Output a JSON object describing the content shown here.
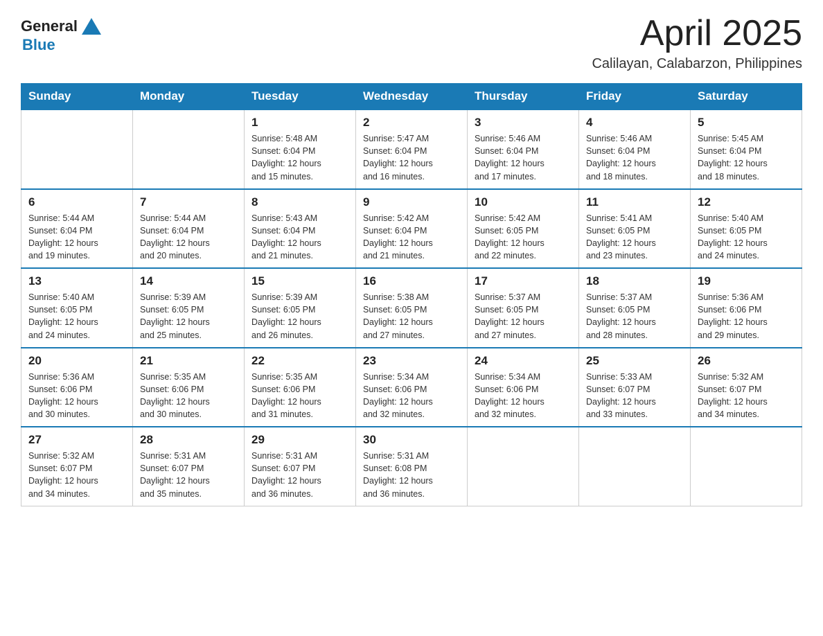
{
  "header": {
    "logo_text_general": "General",
    "logo_text_blue": "Blue",
    "title": "April 2025",
    "subtitle": "Calilayan, Calabarzon, Philippines"
  },
  "days_of_week": [
    "Sunday",
    "Monday",
    "Tuesday",
    "Wednesday",
    "Thursday",
    "Friday",
    "Saturday"
  ],
  "weeks": [
    [
      {
        "day": "",
        "info": ""
      },
      {
        "day": "",
        "info": ""
      },
      {
        "day": "1",
        "info": "Sunrise: 5:48 AM\nSunset: 6:04 PM\nDaylight: 12 hours\nand 15 minutes."
      },
      {
        "day": "2",
        "info": "Sunrise: 5:47 AM\nSunset: 6:04 PM\nDaylight: 12 hours\nand 16 minutes."
      },
      {
        "day": "3",
        "info": "Sunrise: 5:46 AM\nSunset: 6:04 PM\nDaylight: 12 hours\nand 17 minutes."
      },
      {
        "day": "4",
        "info": "Sunrise: 5:46 AM\nSunset: 6:04 PM\nDaylight: 12 hours\nand 18 minutes."
      },
      {
        "day": "5",
        "info": "Sunrise: 5:45 AM\nSunset: 6:04 PM\nDaylight: 12 hours\nand 18 minutes."
      }
    ],
    [
      {
        "day": "6",
        "info": "Sunrise: 5:44 AM\nSunset: 6:04 PM\nDaylight: 12 hours\nand 19 minutes."
      },
      {
        "day": "7",
        "info": "Sunrise: 5:44 AM\nSunset: 6:04 PM\nDaylight: 12 hours\nand 20 minutes."
      },
      {
        "day": "8",
        "info": "Sunrise: 5:43 AM\nSunset: 6:04 PM\nDaylight: 12 hours\nand 21 minutes."
      },
      {
        "day": "9",
        "info": "Sunrise: 5:42 AM\nSunset: 6:04 PM\nDaylight: 12 hours\nand 21 minutes."
      },
      {
        "day": "10",
        "info": "Sunrise: 5:42 AM\nSunset: 6:05 PM\nDaylight: 12 hours\nand 22 minutes."
      },
      {
        "day": "11",
        "info": "Sunrise: 5:41 AM\nSunset: 6:05 PM\nDaylight: 12 hours\nand 23 minutes."
      },
      {
        "day": "12",
        "info": "Sunrise: 5:40 AM\nSunset: 6:05 PM\nDaylight: 12 hours\nand 24 minutes."
      }
    ],
    [
      {
        "day": "13",
        "info": "Sunrise: 5:40 AM\nSunset: 6:05 PM\nDaylight: 12 hours\nand 24 minutes."
      },
      {
        "day": "14",
        "info": "Sunrise: 5:39 AM\nSunset: 6:05 PM\nDaylight: 12 hours\nand 25 minutes."
      },
      {
        "day": "15",
        "info": "Sunrise: 5:39 AM\nSunset: 6:05 PM\nDaylight: 12 hours\nand 26 minutes."
      },
      {
        "day": "16",
        "info": "Sunrise: 5:38 AM\nSunset: 6:05 PM\nDaylight: 12 hours\nand 27 minutes."
      },
      {
        "day": "17",
        "info": "Sunrise: 5:37 AM\nSunset: 6:05 PM\nDaylight: 12 hours\nand 27 minutes."
      },
      {
        "day": "18",
        "info": "Sunrise: 5:37 AM\nSunset: 6:05 PM\nDaylight: 12 hours\nand 28 minutes."
      },
      {
        "day": "19",
        "info": "Sunrise: 5:36 AM\nSunset: 6:06 PM\nDaylight: 12 hours\nand 29 minutes."
      }
    ],
    [
      {
        "day": "20",
        "info": "Sunrise: 5:36 AM\nSunset: 6:06 PM\nDaylight: 12 hours\nand 30 minutes."
      },
      {
        "day": "21",
        "info": "Sunrise: 5:35 AM\nSunset: 6:06 PM\nDaylight: 12 hours\nand 30 minutes."
      },
      {
        "day": "22",
        "info": "Sunrise: 5:35 AM\nSunset: 6:06 PM\nDaylight: 12 hours\nand 31 minutes."
      },
      {
        "day": "23",
        "info": "Sunrise: 5:34 AM\nSunset: 6:06 PM\nDaylight: 12 hours\nand 32 minutes."
      },
      {
        "day": "24",
        "info": "Sunrise: 5:34 AM\nSunset: 6:06 PM\nDaylight: 12 hours\nand 32 minutes."
      },
      {
        "day": "25",
        "info": "Sunrise: 5:33 AM\nSunset: 6:07 PM\nDaylight: 12 hours\nand 33 minutes."
      },
      {
        "day": "26",
        "info": "Sunrise: 5:32 AM\nSunset: 6:07 PM\nDaylight: 12 hours\nand 34 minutes."
      }
    ],
    [
      {
        "day": "27",
        "info": "Sunrise: 5:32 AM\nSunset: 6:07 PM\nDaylight: 12 hours\nand 34 minutes."
      },
      {
        "day": "28",
        "info": "Sunrise: 5:31 AM\nSunset: 6:07 PM\nDaylight: 12 hours\nand 35 minutes."
      },
      {
        "day": "29",
        "info": "Sunrise: 5:31 AM\nSunset: 6:07 PM\nDaylight: 12 hours\nand 36 minutes."
      },
      {
        "day": "30",
        "info": "Sunrise: 5:31 AM\nSunset: 6:08 PM\nDaylight: 12 hours\nand 36 minutes."
      },
      {
        "day": "",
        "info": ""
      },
      {
        "day": "",
        "info": ""
      },
      {
        "day": "",
        "info": ""
      }
    ]
  ]
}
